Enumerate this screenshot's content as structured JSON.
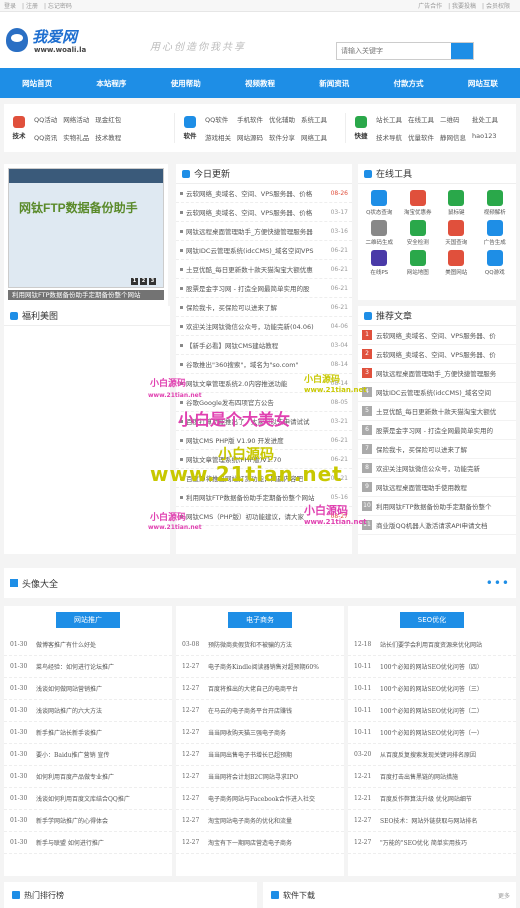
{
  "topbar": {
    "left": [
      "登录",
      "注册",
      "忘记密码"
    ],
    "right": [
      "广告合作",
      "我要投稿",
      "会员权限"
    ]
  },
  "header": {
    "brand": "我爱网",
    "url": "www.woali.la",
    "slogan": "用心创造你我共享",
    "search_placeholder": "请输入关键字"
  },
  "nav": [
    "网站首页",
    "本站程序",
    "使用帮助",
    "视频教程",
    "新闻资讯",
    "付款方式",
    "网站互联"
  ],
  "cats": [
    {
      "label": "技术",
      "links": [
        "QQ活动",
        "网络活动",
        "现金红包",
        "QQ资讯",
        "实物礼品",
        "技术教程"
      ]
    },
    {
      "label": "软件",
      "links": [
        "QQ软件",
        "手机软件",
        "优化辅助",
        "系统工具",
        "游戏相关",
        "网站源码",
        "软件分享",
        "网络工具"
      ]
    },
    {
      "label": "快捷",
      "links": [
        "站长工具",
        "在线工具",
        "二维码",
        "批处工具",
        "技术导航",
        "优量软件",
        "静网信息",
        "hao123"
      ]
    }
  ],
  "banner": {
    "title": "网钛FTP数据备份助手",
    "caption": "利用网钛FTP数据备份助手定期备份整个网站",
    "dots": [
      "1",
      "2",
      "3"
    ]
  },
  "today": {
    "title": "今日更新",
    "items": [
      {
        "t": "云软网络_卖域名、空间、VPS服务器、价格",
        "d": "08-26",
        "red": true
      },
      {
        "t": "云软网络_卖域名、空间、VPS服务器、价格",
        "d": "03-17"
      },
      {
        "t": "网钛远程桌面管理助手_方便快捷管理服务器",
        "d": "03-16"
      },
      {
        "t": "网钛IDC云管理系统(idcCMS)_域名空间VPS",
        "d": "06-21"
      },
      {
        "t": "土豆优酷_每日更新数十款天猫淘宝大额优惠",
        "d": "06-21"
      },
      {
        "t": "股票是金字习网 - 打造全网最简单实用的股",
        "d": "06-21"
      },
      {
        "t": "保险我卡，买保险可以进来了解",
        "d": "06-21"
      },
      {
        "t": "欢迎关注网钛微信公众号，功能完新(04.06)",
        "d": "04-06"
      },
      {
        "t": "【新手必看】网钛CMS建站教程",
        "d": "03-04"
      },
      {
        "t": "谷歌推出\"360搜索\"，域名为\"so.com\"",
        "d": "08-14"
      },
      {
        "t": "网钛文章管理系统2.0内容推送功能",
        "d": "08-14"
      },
      {
        "t": "谷歌Google发布四项官方公告",
        "d": "08-05"
      },
      {
        "t": "百度打算功能推出了，大家可以去申请试试",
        "d": "03-21"
      },
      {
        "t": "网钛CMS PHP版 V1.90 开发进度",
        "d": "06-21"
      },
      {
        "t": "网钛文章管理系统(PHP版)V1.70",
        "d": "06-21"
      },
      {
        "t": "百度即将推出网站打赏功能，网赢内容吧",
        "d": "06-21"
      },
      {
        "t": "利用网钛FTP数据备份助手定期备份整个网站",
        "d": "05-16"
      },
      {
        "t": "网钛CMS（PHP版）初功能建议，请大家",
        "d": "08-27",
        "red": true
      }
    ]
  },
  "tools": {
    "title": "在线工具",
    "items": [
      "Q状态查询",
      "淘宝优惠券",
      "鼠标键",
      "视频解析",
      "二维码生成",
      "安全检测",
      "天国查询",
      "广告生成",
      "在线PS",
      "网站地图",
      "美图网站",
      "QQ游戏"
    ]
  },
  "recommend": {
    "title": "推荐文章",
    "items": [
      "云软网络_卖域名、空间、VPS服务器、价",
      "云软网络_卖域名、空间、VPS服务器、价",
      "网钛远程桌面管理助手_方便快捷管理服务",
      "网钛IDC云管理系统(idcCMS)_域名空间",
      "土豆优酷_每日更新数十款天猫淘宝大额优",
      "股票是金字习网 - 打造全网最简单实用的",
      "保险我卡，买保险可以进来了解",
      "欢迎关注网钛微信公众号，功能完新",
      "网钛远程桌面管理助手使用教程",
      "利用网钛FTP数据备份助手定期备份整个",
      "商业版QQ机器人激活请求API申请文档"
    ]
  },
  "fuli": {
    "title": "福利美图"
  },
  "watermarks": [
    "小白源码",
    "www.21tian.net",
    "小白是个大美女",
    "小白源码",
    "www.21tian.net",
    "小白源码",
    "www.21tian.net",
    "小白源码",
    "www.21tian.net",
    "小白源码",
    "www.21tian.net"
  ],
  "avatar": {
    "title": "头像大全",
    "more": "•••"
  },
  "columns": [
    {
      "tag": "网站推广",
      "items": [
        {
          "d": "01-30",
          "t": "做博客推广有什么好处"
        },
        {
          "d": "01-30",
          "t": "菜鸟经验：如何进行论坛推广"
        },
        {
          "d": "01-30",
          "t": "浅谈如何做网站营销推广"
        },
        {
          "d": "01-30",
          "t": "浅谈网站推广的六大方法"
        },
        {
          "d": "01-30",
          "t": "新手推广站长新手谈推广"
        },
        {
          "d": "01-30",
          "t": "要小：Baidu推广营销 宣传"
        },
        {
          "d": "01-30",
          "t": "如何利用百度产品做专业推广"
        },
        {
          "d": "01-30",
          "t": "浅谈如何利用百度文库结合QQ推广"
        },
        {
          "d": "01-30",
          "t": "新手学网站推广的心得体会"
        },
        {
          "d": "01-30",
          "t": "新手与联盟 如何进行推广"
        }
      ]
    },
    {
      "tag": "电子商务",
      "items": [
        {
          "d": "03-08",
          "t": "预防微商卖假货和不被骗的方法"
        },
        {
          "d": "12-27",
          "t": "电子商务Kindle阅读器销售对超预期60%"
        },
        {
          "d": "12-27",
          "t": "百度将推出的大佬自己的电商平台"
        },
        {
          "d": "12-27",
          "t": "在马云的电子商务平台开店赚钱"
        },
        {
          "d": "12-27",
          "t": "当当网收购天猫三强电子商务"
        },
        {
          "d": "12-27",
          "t": "当当网出售电子书增长已超预期"
        },
        {
          "d": "12-27",
          "t": "当当网将会计划B2C网站寻求IPO"
        },
        {
          "d": "12-27",
          "t": "电子商务网站与Facebook合作进入社交"
        },
        {
          "d": "12-27",
          "t": "淘宝网站电子商务的优化和流量"
        },
        {
          "d": "12-27",
          "t": "淘宝有下一期网店营造电子商务"
        }
      ]
    },
    {
      "tag": "SEO优化",
      "items": [
        {
          "d": "12-18",
          "t": "站长们要学会利用百度资源来优化网站"
        },
        {
          "d": "10-11",
          "t": "100个必知的网站SEO优化问答（四）"
        },
        {
          "d": "10-11",
          "t": "100个必知的网站SEO优化问答（三）"
        },
        {
          "d": "10-11",
          "t": "100个必知的网站SEO优化问答（二）"
        },
        {
          "d": "10-11",
          "t": "100个必知的网站SEO优化问答（一）"
        },
        {
          "d": "03-20",
          "t": "从百度反复搜索发现关键词排名原因"
        },
        {
          "d": "12-21",
          "t": "百度打击出售黑链的网站措施"
        },
        {
          "d": "12-21",
          "t": "百度反作弊算法升级 优化网站细节"
        },
        {
          "d": "12-27",
          "t": "SEO技术：网站外链获取与网站排名"
        },
        {
          "d": "12-27",
          "t": "\"万能的\"SEO优化 简单实用技巧"
        }
      ]
    }
  ],
  "bottom": {
    "left": "热门排行榜",
    "right": "软件下载",
    "more": "更多"
  }
}
